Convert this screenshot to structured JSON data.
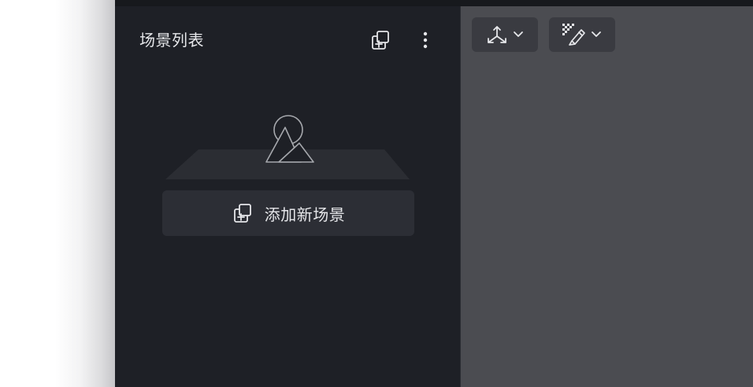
{
  "scene_panel": {
    "title": "场景列表",
    "add_new_scene_label": "添加新场景"
  },
  "toolbar": {
    "tools": [
      {
        "icon": "transform-axes-icon",
        "dropdown": "chevron-down-icon"
      },
      {
        "icon": "checkered-brush-icon",
        "dropdown": "chevron-down-icon"
      }
    ]
  },
  "colors": {
    "panel_bg": "#1e2026",
    "canvas_bg": "#4b4c51",
    "button_bg": "#2c2e35",
    "tool_button_bg": "#3a3b41",
    "text": "#e6e7ea"
  }
}
